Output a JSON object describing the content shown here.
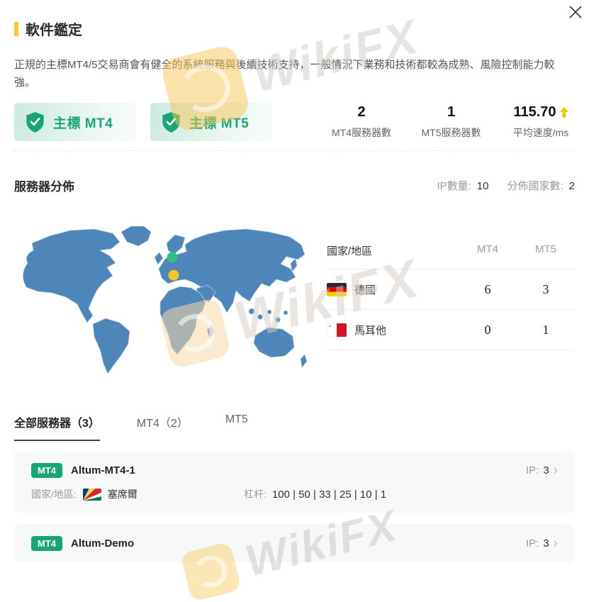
{
  "modal": {
    "close_label": "close"
  },
  "header": {
    "title": "軟件鑑定",
    "accent_color": "#fdc52c"
  },
  "description": "正規的主標MT4/5交易商會有健全的系統服務與後續技術支持，一般情況下業務和技術都較為成熟、風險控制能力較強。",
  "badges": [
    {
      "label": "主標 MT4"
    },
    {
      "label": "主標 MT5"
    }
  ],
  "stats": [
    {
      "value": "2",
      "label": "MT4服務器數"
    },
    {
      "value": "1",
      "label": "MT5服務器數"
    },
    {
      "value": "115.70",
      "label": "平均速度/ms",
      "trend": "up"
    }
  ],
  "distribution": {
    "title": "服務器分佈",
    "ip_count_label": "IP數量:",
    "ip_count": "10",
    "country_count_label": "分佈國家數:",
    "country_count": "2",
    "map": {
      "land_color": "#4e86ba",
      "border_color": "#b7d0e6",
      "markers": [
        {
          "name": "germany-marker",
          "color": "#2fbf83"
        },
        {
          "name": "malta-marker",
          "color": "#f6c51e"
        }
      ]
    },
    "table": {
      "headers": {
        "country": "國家/地區",
        "mt4": "MT4",
        "mt5": "MT5"
      },
      "rows": [
        {
          "country": "德國",
          "flag": "germany-flag",
          "mt4": "6",
          "mt5": "3"
        },
        {
          "country": "馬耳他",
          "flag": "malta-flag",
          "mt4": "0",
          "mt5": "1"
        }
      ]
    }
  },
  "tabs": [
    {
      "label": "全部服務器（3）",
      "active": true
    },
    {
      "label": "MT4（2）",
      "active": false
    },
    {
      "label": "MT5",
      "active": false
    }
  ],
  "servers": [
    {
      "type": "MT4",
      "name": "Altum-MT4-1",
      "ip_label": "IP:",
      "ip": "3",
      "country_label": "國家/地區:",
      "country": "塞席爾",
      "flag": "seychelles-flag",
      "leverage_label": "杠杆:",
      "leverage": "100 | 50 | 33 | 25 | 10 | 1"
    },
    {
      "type": "MT4",
      "name": "Altum-Demo",
      "ip_label": "IP:",
      "ip": "3"
    }
  ],
  "watermark": {
    "text": "WikiFX"
  },
  "colors": {
    "green": "#17a578",
    "yellow": "#fdc52c",
    "map_blue": "#4e86ba",
    "card_bg": "#f7f8f9"
  }
}
